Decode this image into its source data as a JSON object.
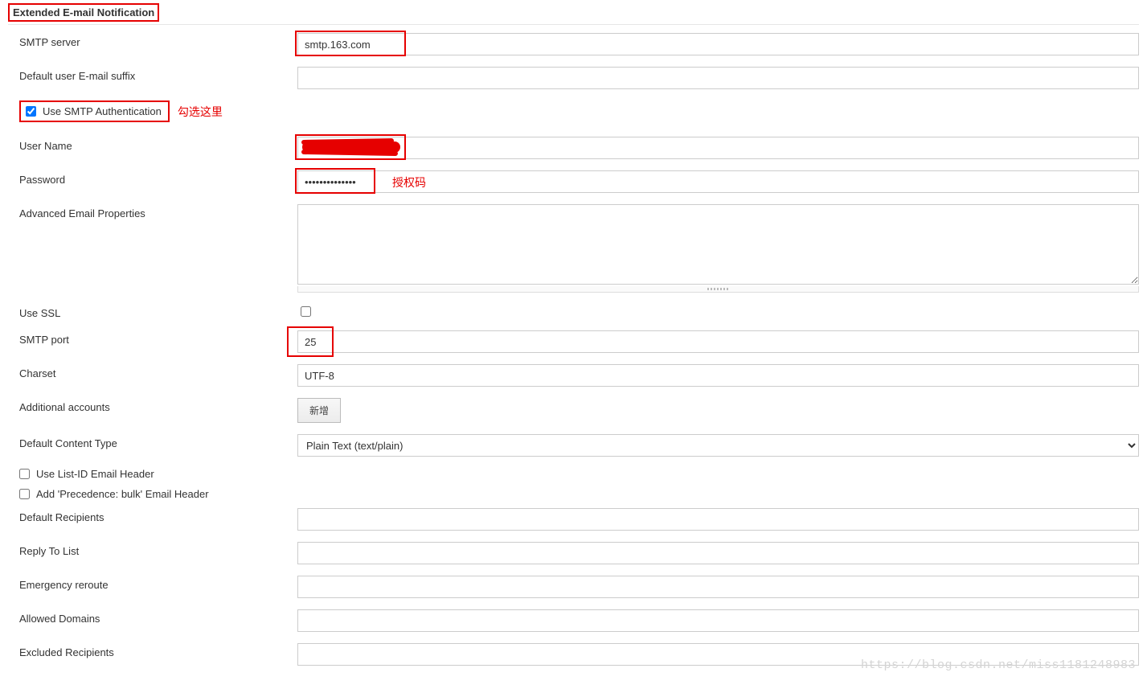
{
  "section_title": "Extended E-mail Notification",
  "fields": {
    "smtp_server": {
      "label": "SMTP server",
      "value": "smtp.163.com"
    },
    "default_suffix": {
      "label": "Default user E-mail suffix",
      "value": ""
    },
    "use_smtp_auth": {
      "label": "Use SMTP Authentication",
      "checked": true
    },
    "user_name": {
      "label": "User Name",
      "value": ""
    },
    "password": {
      "label": "Password",
      "value": "••••••••••••••"
    },
    "adv_props": {
      "label": "Advanced Email Properties",
      "value": ""
    },
    "use_ssl": {
      "label": "Use SSL",
      "checked": false
    },
    "smtp_port": {
      "label": "SMTP port",
      "value": "25"
    },
    "charset": {
      "label": "Charset",
      "value": "UTF-8"
    },
    "additional_accounts": {
      "label": "Additional accounts",
      "button": "新增"
    },
    "default_content_type": {
      "label": "Default Content Type",
      "value": "Plain Text (text/plain)"
    },
    "use_list_id": {
      "label": "Use List-ID Email Header",
      "checked": false
    },
    "add_precedence": {
      "label": "Add 'Precedence: bulk' Email Header",
      "checked": false
    },
    "default_recipients": {
      "label": "Default Recipients",
      "value": ""
    },
    "reply_to_list": {
      "label": "Reply To List",
      "value": ""
    },
    "emergency_reroute": {
      "label": "Emergency reroute",
      "value": ""
    },
    "allowed_domains": {
      "label": "Allowed Domains",
      "value": ""
    },
    "excluded_recipients": {
      "label": "Excluded Recipients",
      "value": ""
    }
  },
  "annotations": {
    "check_here": "勾选这里",
    "auth_code": "授权码"
  },
  "watermark": "https://blog.csdn.net/miss1181248983"
}
